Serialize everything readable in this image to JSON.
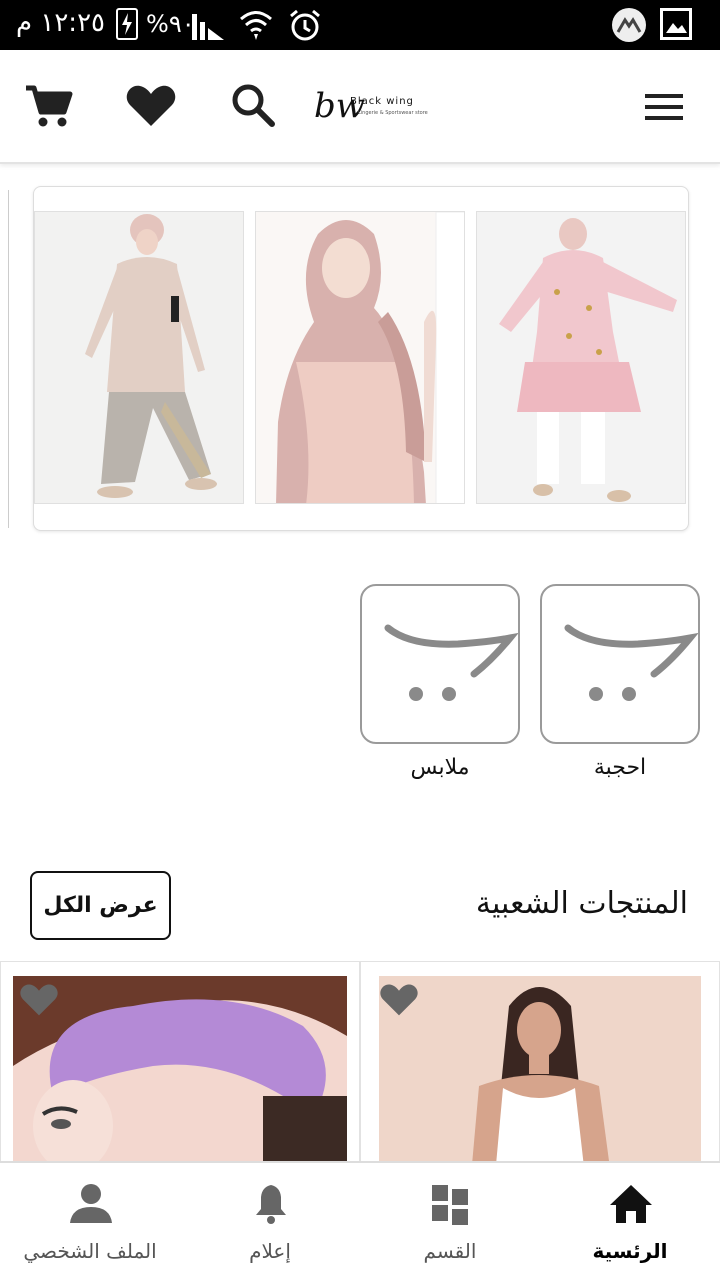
{
  "status_bar": {
    "time": "١٢:٢٥ م",
    "battery": "%٩٠",
    "icons": [
      "battery-icon",
      "signal-icon",
      "wifi-icon",
      "alarm-icon",
      "app-icon",
      "gallery-icon"
    ]
  },
  "header": {
    "logo_mark": "bw",
    "logo_text": "Black wing",
    "logo_sub": "Lingerie & Sportswear store",
    "icons": [
      "cart-icon",
      "heart-icon",
      "search-icon",
      "menu-icon"
    ]
  },
  "categories": [
    {
      "label": "احجبة"
    },
    {
      "label": "ملابس"
    }
  ],
  "popular": {
    "title": "المنتجات الشعبية",
    "view_all": "عرض الكل"
  },
  "bottom_nav": {
    "items": [
      {
        "label": "الرئسية",
        "icon": "home-icon",
        "active": true
      },
      {
        "label": "القسم",
        "icon": "category-icon",
        "active": false
      },
      {
        "label": "إعلام",
        "icon": "bell-icon",
        "active": false
      },
      {
        "label": "الملف الشخصي",
        "icon": "person-icon",
        "active": false
      }
    ]
  },
  "colors": {
    "accent": "#000000",
    "card_border": "#9a9a9a"
  }
}
